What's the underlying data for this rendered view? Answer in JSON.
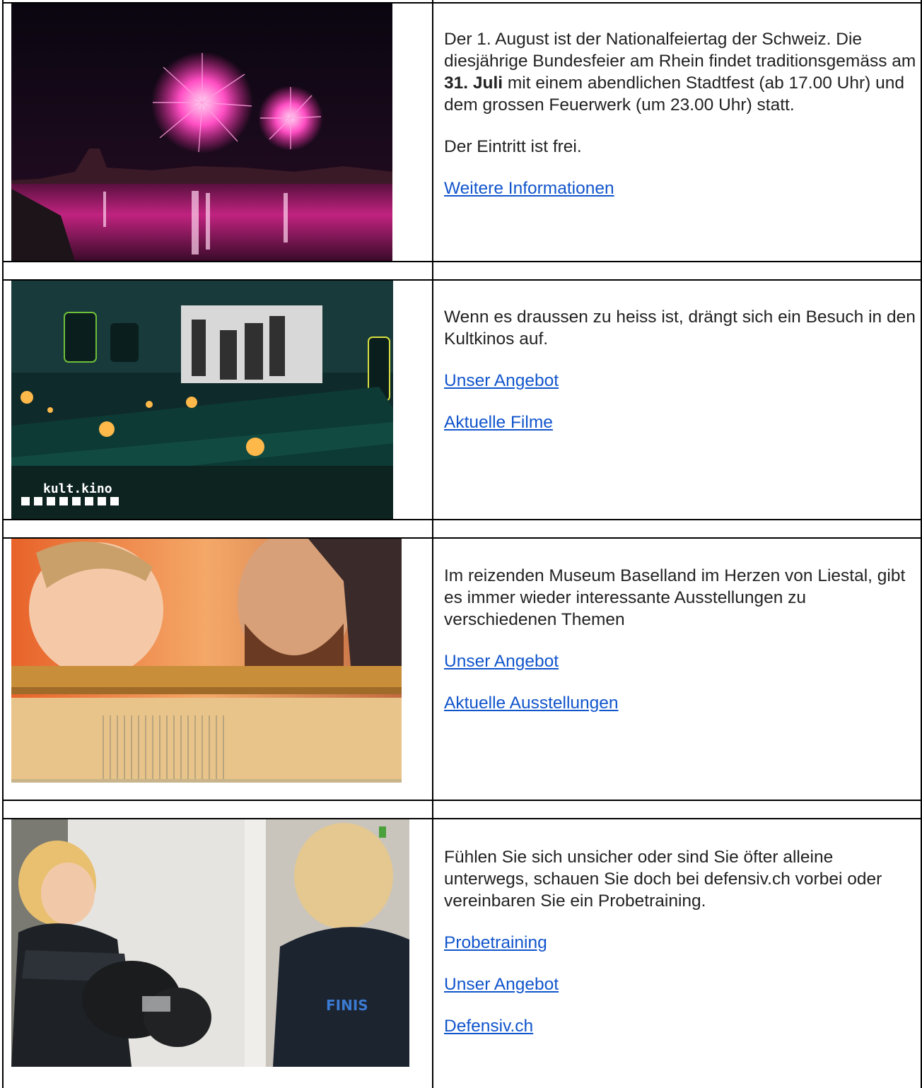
{
  "rows": [
    {
      "image": "fireworks-photo",
      "paragraph": {
        "before": "Der 1. August ist der Nationalfeiertag der Schweiz. Die diesjährige Bundesfeier am Rhein findet traditionsgemäss am ",
        "bold": "31. Juli",
        "after": " mit einem abendlichen Stadtfest (ab 17.00 Uhr) und dem grossen Feuerwerk (um 23.00 Uhr) statt."
      },
      "note": "Der Eintritt ist frei.",
      "links": [
        "Weitere Informationen"
      ]
    },
    {
      "image": "cinema-photo",
      "image_logo_text": "kult.kino",
      "paragraph": "Wenn es draussen zu heiss ist, drängt sich ein Besuch in den Kultkinos auf.",
      "links": [
        "Unser Angebot",
        "Aktuelle Filme"
      ]
    },
    {
      "image": "museum-weaving-photo",
      "paragraph": "Im reizenden Museum Baselland im Herzen von Liestal, gibt es immer wieder interessante Ausstellungen zu verschiedenen Themen",
      "links": [
        "Unser Angebot",
        "Aktuelle Ausstellungen"
      ]
    },
    {
      "image": "self-defense-training-photo",
      "paragraph": "Fühlen Sie sich unsicher oder sind Sie öfter alleine unterwegs, schauen Sie doch bei defensiv.ch vorbei oder vereinbaren Sie ein Probetraining.",
      "links": [
        "Probetraining",
        "Unser Angebot",
        "Defensiv.ch"
      ]
    }
  ],
  "colors": {
    "link": "#1155cc",
    "border": "#000000"
  }
}
